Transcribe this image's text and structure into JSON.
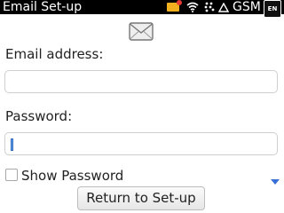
{
  "status_bar": {
    "title": "Email Set-up",
    "network": "GSM",
    "language": "EN",
    "icons": [
      "new-mail-icon",
      "wifi-icon",
      "blackberry-icon",
      "roaming-triangle-icon"
    ]
  },
  "form": {
    "email_label": "Email address:",
    "email_value": "",
    "password_label": "Password:",
    "password_value": "",
    "show_password_label": "Show Password",
    "show_password_checked": false
  },
  "footer": {
    "return_button_label": "Return to Set-up"
  },
  "colors": {
    "status_bar_bg": "#000000",
    "background": "#ffffff",
    "mail_badge": "#f2b01e",
    "cursor_blue": "#2f6cc4",
    "scroll_arrow": "#3a6fd8"
  }
}
